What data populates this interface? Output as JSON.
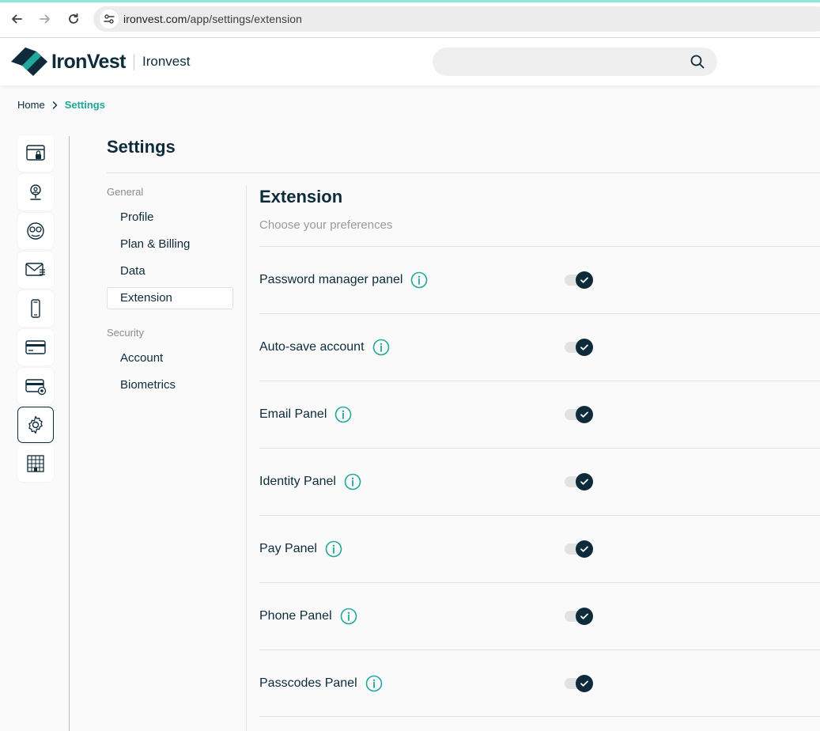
{
  "browser": {
    "url_domain": "ironvest.com",
    "url_path": "/app/settings/extension"
  },
  "header": {
    "brand": "IronVest",
    "org_name": "Ironvest",
    "search_placeholder": ""
  },
  "breadcrumb": {
    "home": "Home",
    "current": "Settings"
  },
  "rail": {
    "items": [
      {
        "icon": "browser-lock-icon"
      },
      {
        "icon": "location-pin-icon"
      },
      {
        "icon": "masked-identity-icon"
      },
      {
        "icon": "masked-email-icon"
      },
      {
        "icon": "mobile-phone-icon"
      },
      {
        "icon": "credit-card-icon"
      },
      {
        "icon": "card-settings-icon"
      },
      {
        "icon": "gear-icon",
        "active": true
      },
      {
        "icon": "building-icon"
      }
    ]
  },
  "settings": {
    "title": "Settings",
    "groups": [
      {
        "label": "General",
        "items": [
          "Profile",
          "Plan & Billing",
          "Data",
          "Extension"
        ]
      },
      {
        "label": "Security",
        "items": [
          "Account",
          "Biometrics"
        ]
      }
    ],
    "active_item": "Extension"
  },
  "panel": {
    "title": "Extension",
    "subtitle": "Choose your preferences",
    "options": [
      {
        "label": "Password manager panel",
        "enabled": true
      },
      {
        "label": "Auto-save account",
        "enabled": true
      },
      {
        "label": "Email Panel",
        "enabled": true
      },
      {
        "label": "Identity Panel",
        "enabled": true
      },
      {
        "label": "Pay Panel",
        "enabled": true
      },
      {
        "label": "Phone Panel",
        "enabled": true
      },
      {
        "label": "Passcodes Panel",
        "enabled": true
      }
    ]
  },
  "colors": {
    "brand_dark": "#0d2b3a",
    "accent_teal": "#1fa89b",
    "background": "#fafafa"
  }
}
